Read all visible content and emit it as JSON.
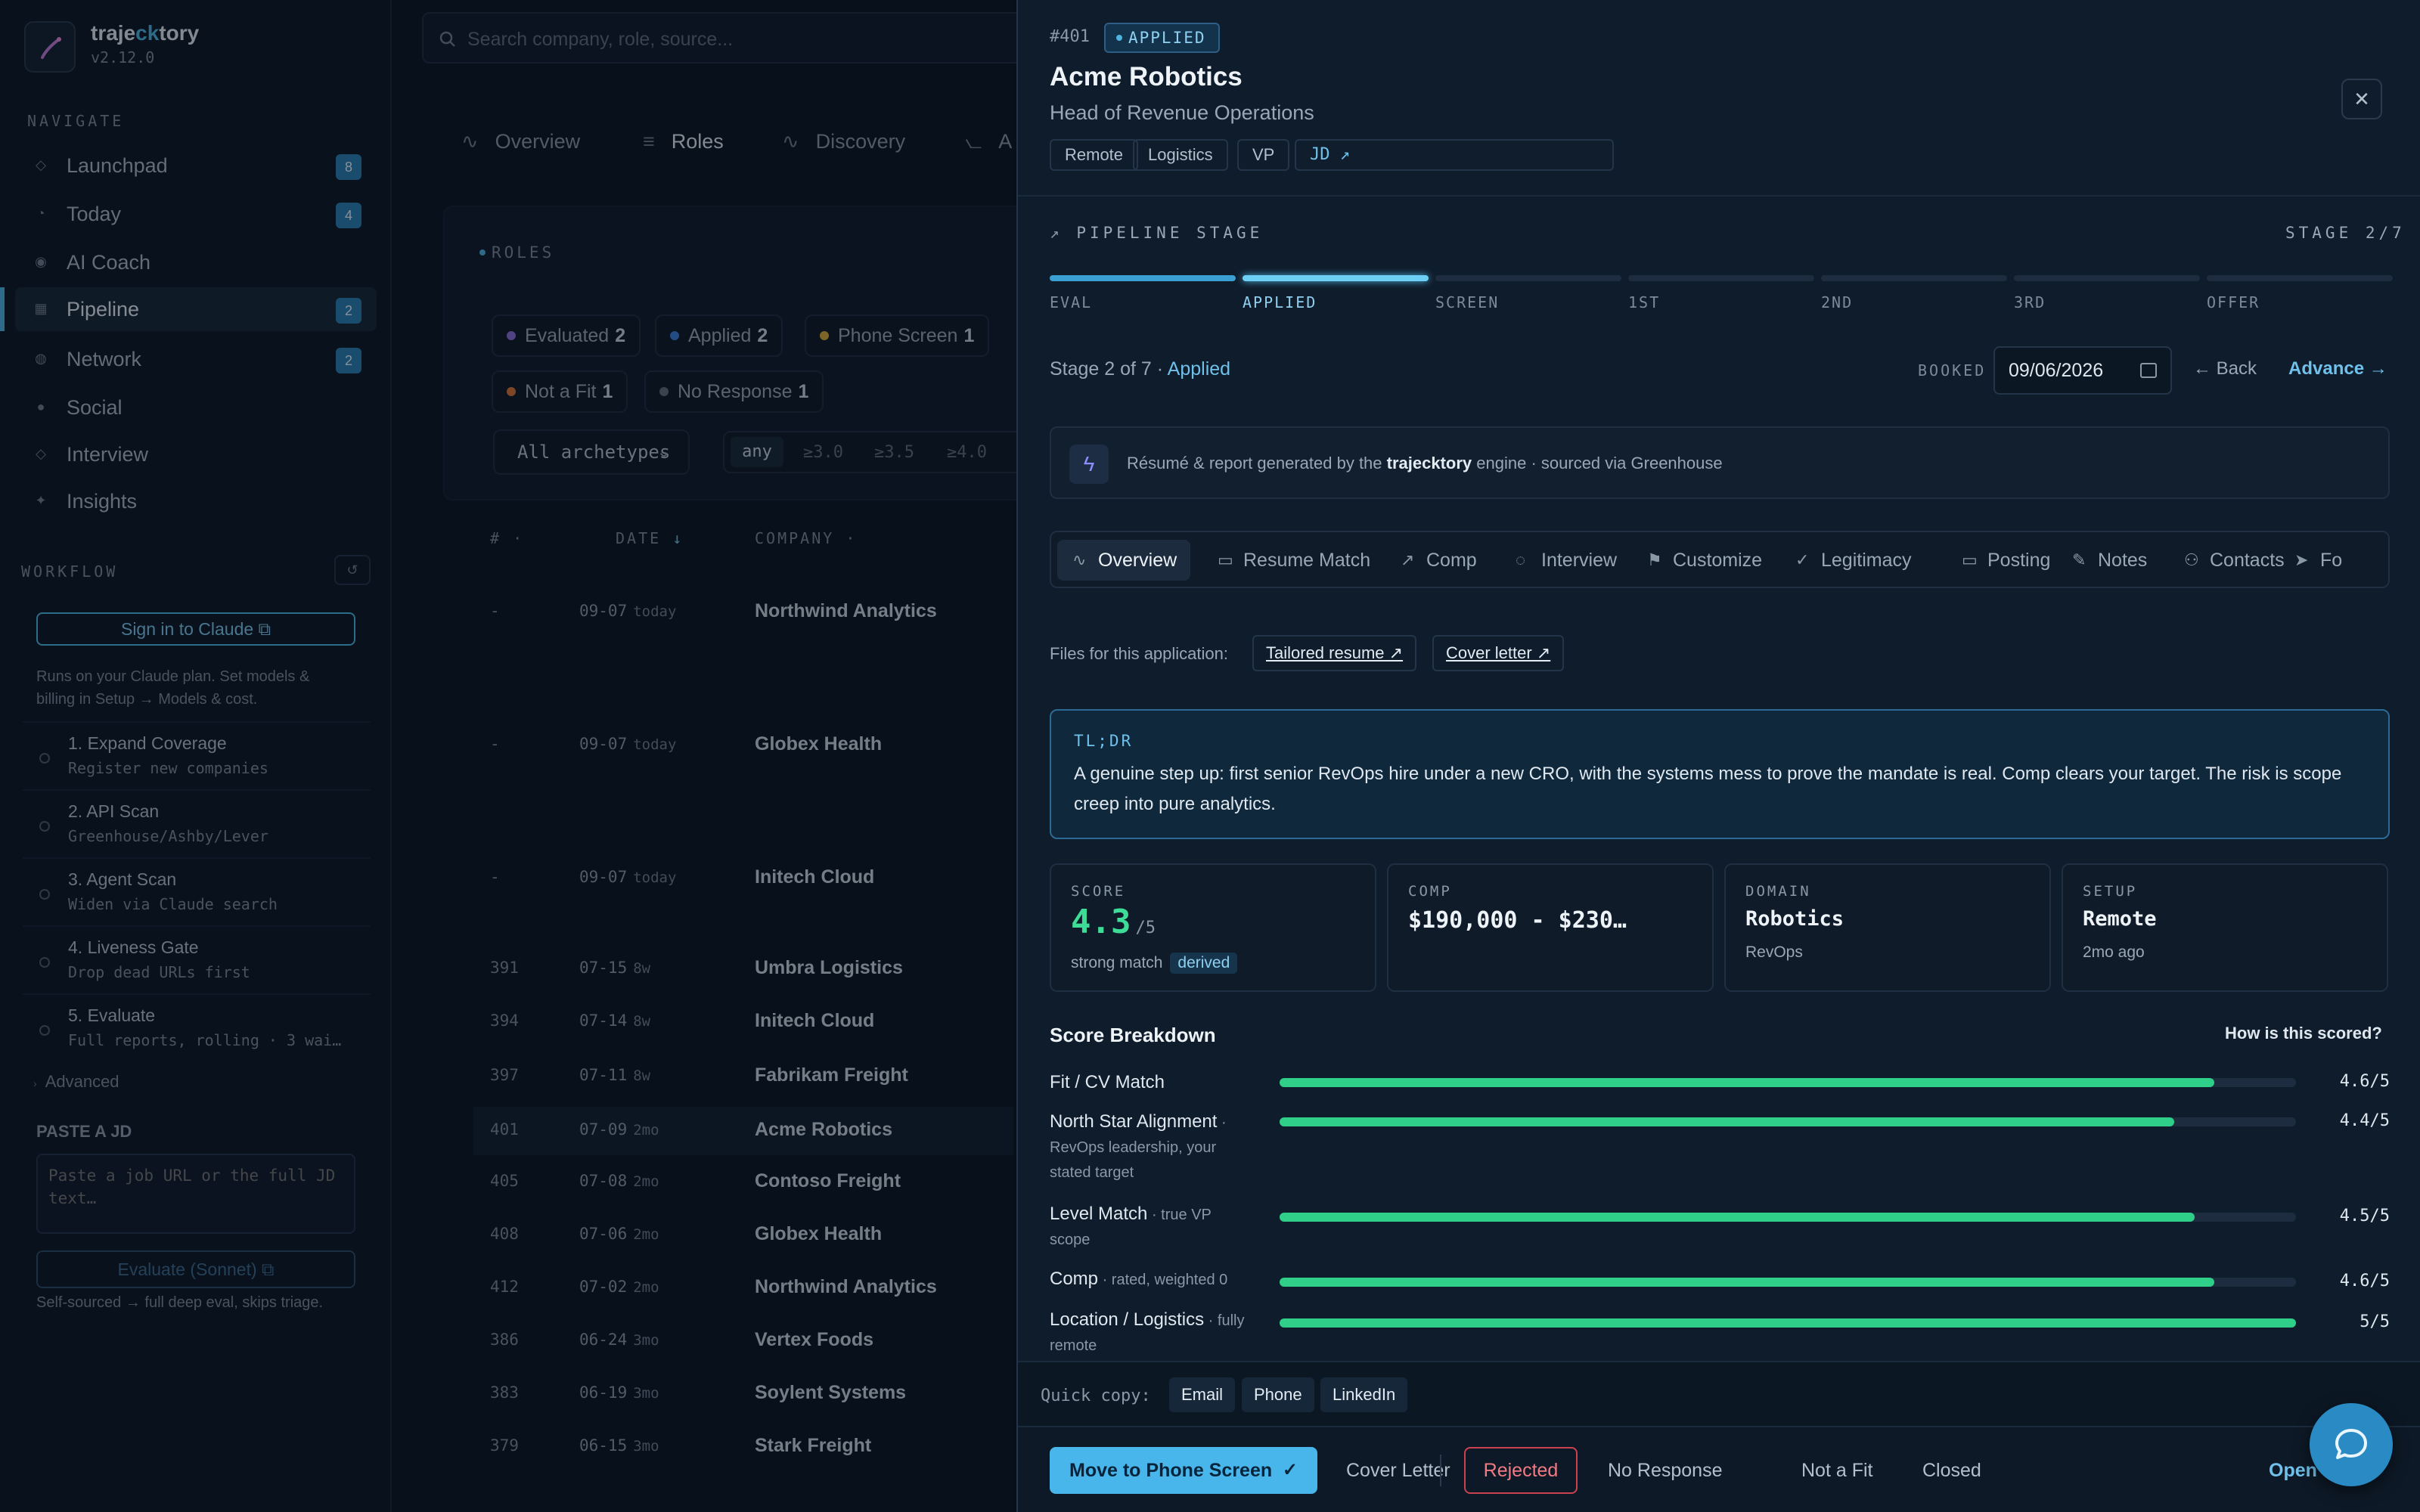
{
  "app": {
    "name_pre": "traje",
    "name_mid": "ck",
    "name_post": "tory",
    "version": "v2.12.0"
  },
  "sidebar": {
    "navigate_label": "NAVIGATE",
    "nav": [
      {
        "label": "Launchpad",
        "badge": "8",
        "icon": "diamond-icon"
      },
      {
        "label": "Today",
        "badge": "4",
        "icon": "clock-icon"
      },
      {
        "label": "AI Coach",
        "badge": "",
        "icon": "target-icon"
      },
      {
        "label": "Pipeline",
        "badge": "2",
        "icon": "grid-icon"
      },
      {
        "label": "Network",
        "badge": "2",
        "icon": "globe-icon"
      },
      {
        "label": "Social",
        "badge": "",
        "icon": "circle-icon"
      },
      {
        "label": "Interview",
        "badge": "",
        "icon": "diamond-icon"
      },
      {
        "label": "Insights",
        "badge": "",
        "icon": "sparkle-icon"
      }
    ],
    "workflow_label": "WORKFLOW",
    "signin": "Sign in to Claude",
    "plan_note_1": "Runs on your Claude plan. Set models &",
    "plan_note_2": "billing in Setup → Models & cost.",
    "steps": [
      {
        "title": "1. Expand Coverage",
        "sub": "Register new companies"
      },
      {
        "title": "2. API Scan",
        "sub": "Greenhouse/Ashby/Lever"
      },
      {
        "title": "3. Agent Scan",
        "sub": "Widen via Claude search"
      },
      {
        "title": "4. Liveness Gate",
        "sub": "Drop dead URLs first"
      },
      {
        "title": "5. Evaluate",
        "sub": "Full reports, rolling · 3 wai…"
      }
    ],
    "advanced": "Advanced",
    "paste_label": "PASTE A JD",
    "paste_placeholder": "Paste a job URL or the full JD text…",
    "evaluate_button": "Evaluate (Sonnet)",
    "self_note": "Self-sourced → full deep eval, skips triage."
  },
  "main": {
    "search_placeholder": "Search company, role, source...",
    "tabs": [
      "Overview",
      "Roles",
      "Discovery",
      "A"
    ],
    "roles_label": "ROLES",
    "filters": [
      {
        "label": "Evaluated",
        "count": "2",
        "color": "#8b6fd6"
      },
      {
        "label": "Applied",
        "count": "2",
        "color": "#3a7fd6"
      },
      {
        "label": "Phone Screen",
        "count": "1",
        "color": "#d6a93a"
      },
      {
        "label": "Not a Fit",
        "count": "1",
        "color": "#d6743a"
      },
      {
        "label": "No Response",
        "count": "1",
        "color": "#5f6e7d"
      }
    ],
    "archetype_select": "All archetypes",
    "score_options": [
      "any",
      "≥3.0",
      "≥3.5",
      "≥4.0"
    ],
    "columns": [
      "#",
      "DATE",
      "COMPANY"
    ],
    "rows": [
      {
        "id": "-",
        "date": "09-07",
        "ago": "today",
        "company": "Northwind Analytics"
      },
      {
        "id": "-",
        "date": "09-07",
        "ago": "today",
        "company": "Globex Health"
      },
      {
        "id": "-",
        "date": "09-07",
        "ago": "today",
        "company": "Initech Cloud"
      },
      {
        "id": "391",
        "date": "07-15",
        "ago": "8w",
        "company": "Umbra Logistics"
      },
      {
        "id": "394",
        "date": "07-14",
        "ago": "8w",
        "company": "Initech Cloud"
      },
      {
        "id": "397",
        "date": "07-11",
        "ago": "8w",
        "company": "Fabrikam Freight"
      },
      {
        "id": "401",
        "date": "07-09",
        "ago": "2mo",
        "company": "Acme Robotics"
      },
      {
        "id": "405",
        "date": "07-08",
        "ago": "2mo",
        "company": "Contoso Freight"
      },
      {
        "id": "408",
        "date": "07-06",
        "ago": "2mo",
        "company": "Globex Health"
      },
      {
        "id": "412",
        "date": "07-02",
        "ago": "2mo",
        "company": "Northwind Analytics"
      },
      {
        "id": "386",
        "date": "06-24",
        "ago": "3mo",
        "company": "Vertex Foods"
      },
      {
        "id": "383",
        "date": "06-19",
        "ago": "3mo",
        "company": "Soylent Systems"
      },
      {
        "id": "379",
        "date": "06-15",
        "ago": "3mo",
        "company": "Stark Freight"
      }
    ]
  },
  "detail": {
    "id": "#401",
    "status": "APPLIED",
    "company": "Acme Robotics",
    "role": "Head of Revenue Operations",
    "tags": [
      "Remote",
      "Logistics",
      "VP"
    ],
    "jd_link": "JD ↗",
    "pipeline_label": "PIPELINE STAGE",
    "stage_count": "STAGE 2/7",
    "stages": [
      "EVAL",
      "APPLIED",
      "SCREEN",
      "1ST",
      "2ND",
      "3RD",
      "OFFER"
    ],
    "stage_text": "Stage 2 of 7 · ",
    "stage_name": "Applied",
    "booked_label": "BOOKED",
    "booked_date": "09/06/2026",
    "back": "← Back",
    "advance": "Advance →",
    "engine_pre": "Résumé & report generated by the ",
    "engine_name": "trajecktory",
    "engine_post": " engine · sourced via Greenhouse",
    "tabs": [
      {
        "label": "Overview",
        "icon": "pulse-icon"
      },
      {
        "label": "Resume Match",
        "icon": "briefcase-icon"
      },
      {
        "label": "Comp",
        "icon": "trend-icon"
      },
      {
        "label": "Interview",
        "icon": "chat-icon"
      },
      {
        "label": "Customize",
        "icon": "flag-icon"
      },
      {
        "label": "Legitimacy",
        "icon": "check-icon"
      },
      {
        "label": "Posting",
        "icon": "briefcase-icon"
      },
      {
        "label": "Notes",
        "icon": "pencil-icon"
      },
      {
        "label": "Contacts",
        "icon": "people-icon"
      },
      {
        "label": "Fo",
        "icon": "send-icon"
      }
    ],
    "files_label": "Files for this application:",
    "file_links": [
      "Tailored resume ↗",
      "Cover letter ↗"
    ],
    "tldr_label": "TL;DR",
    "tldr": "A genuine step up: first senior RevOps hire under a new CRO, with the systems mess to prove the mandate is real. Comp clears your target. The risk is scope creep into pure analytics.",
    "stats": [
      {
        "key": "SCORE",
        "value": "4.3",
        "of": "/5",
        "meta": "strong match",
        "badge": "derived"
      },
      {
        "key": "COMP",
        "value": "$190,000 - $230…",
        "meta": ""
      },
      {
        "key": "DOMAIN",
        "value": "Robotics",
        "meta": "RevOps"
      },
      {
        "key": "SETUP",
        "value": "Remote",
        "meta": "2mo ago"
      }
    ],
    "breakdown_title": "Score Breakdown",
    "how_scored": "How is this scored?",
    "breakdown": [
      {
        "label": "Fit / CV Match",
        "note": "",
        "score": 4.6,
        "display": "4.6/5"
      },
      {
        "label": "North Star Alignment",
        "note": " · RevOps leadership, your stated target",
        "score": 4.4,
        "display": "4.4/5"
      },
      {
        "label": "Level Match",
        "note": " · true VP scope",
        "score": 4.5,
        "display": "4.5/5"
      },
      {
        "label": "Comp",
        "note": " · rated, weighted 0",
        "score": 4.6,
        "display": "4.6/5"
      },
      {
        "label": "Location / Logistics",
        "note": " · fully remote",
        "score": 5,
        "display": "5/5"
      }
    ],
    "quick_copy_label": "Quick copy:",
    "quick_copy": [
      "Email",
      "Phone",
      "LinkedIn"
    ],
    "move_button": "Move to Phone Screen",
    "actions": [
      "Cover Letter",
      "Rejected",
      "No Response",
      "Not a Fit",
      "Closed"
    ],
    "open_link": "Open J"
  }
}
